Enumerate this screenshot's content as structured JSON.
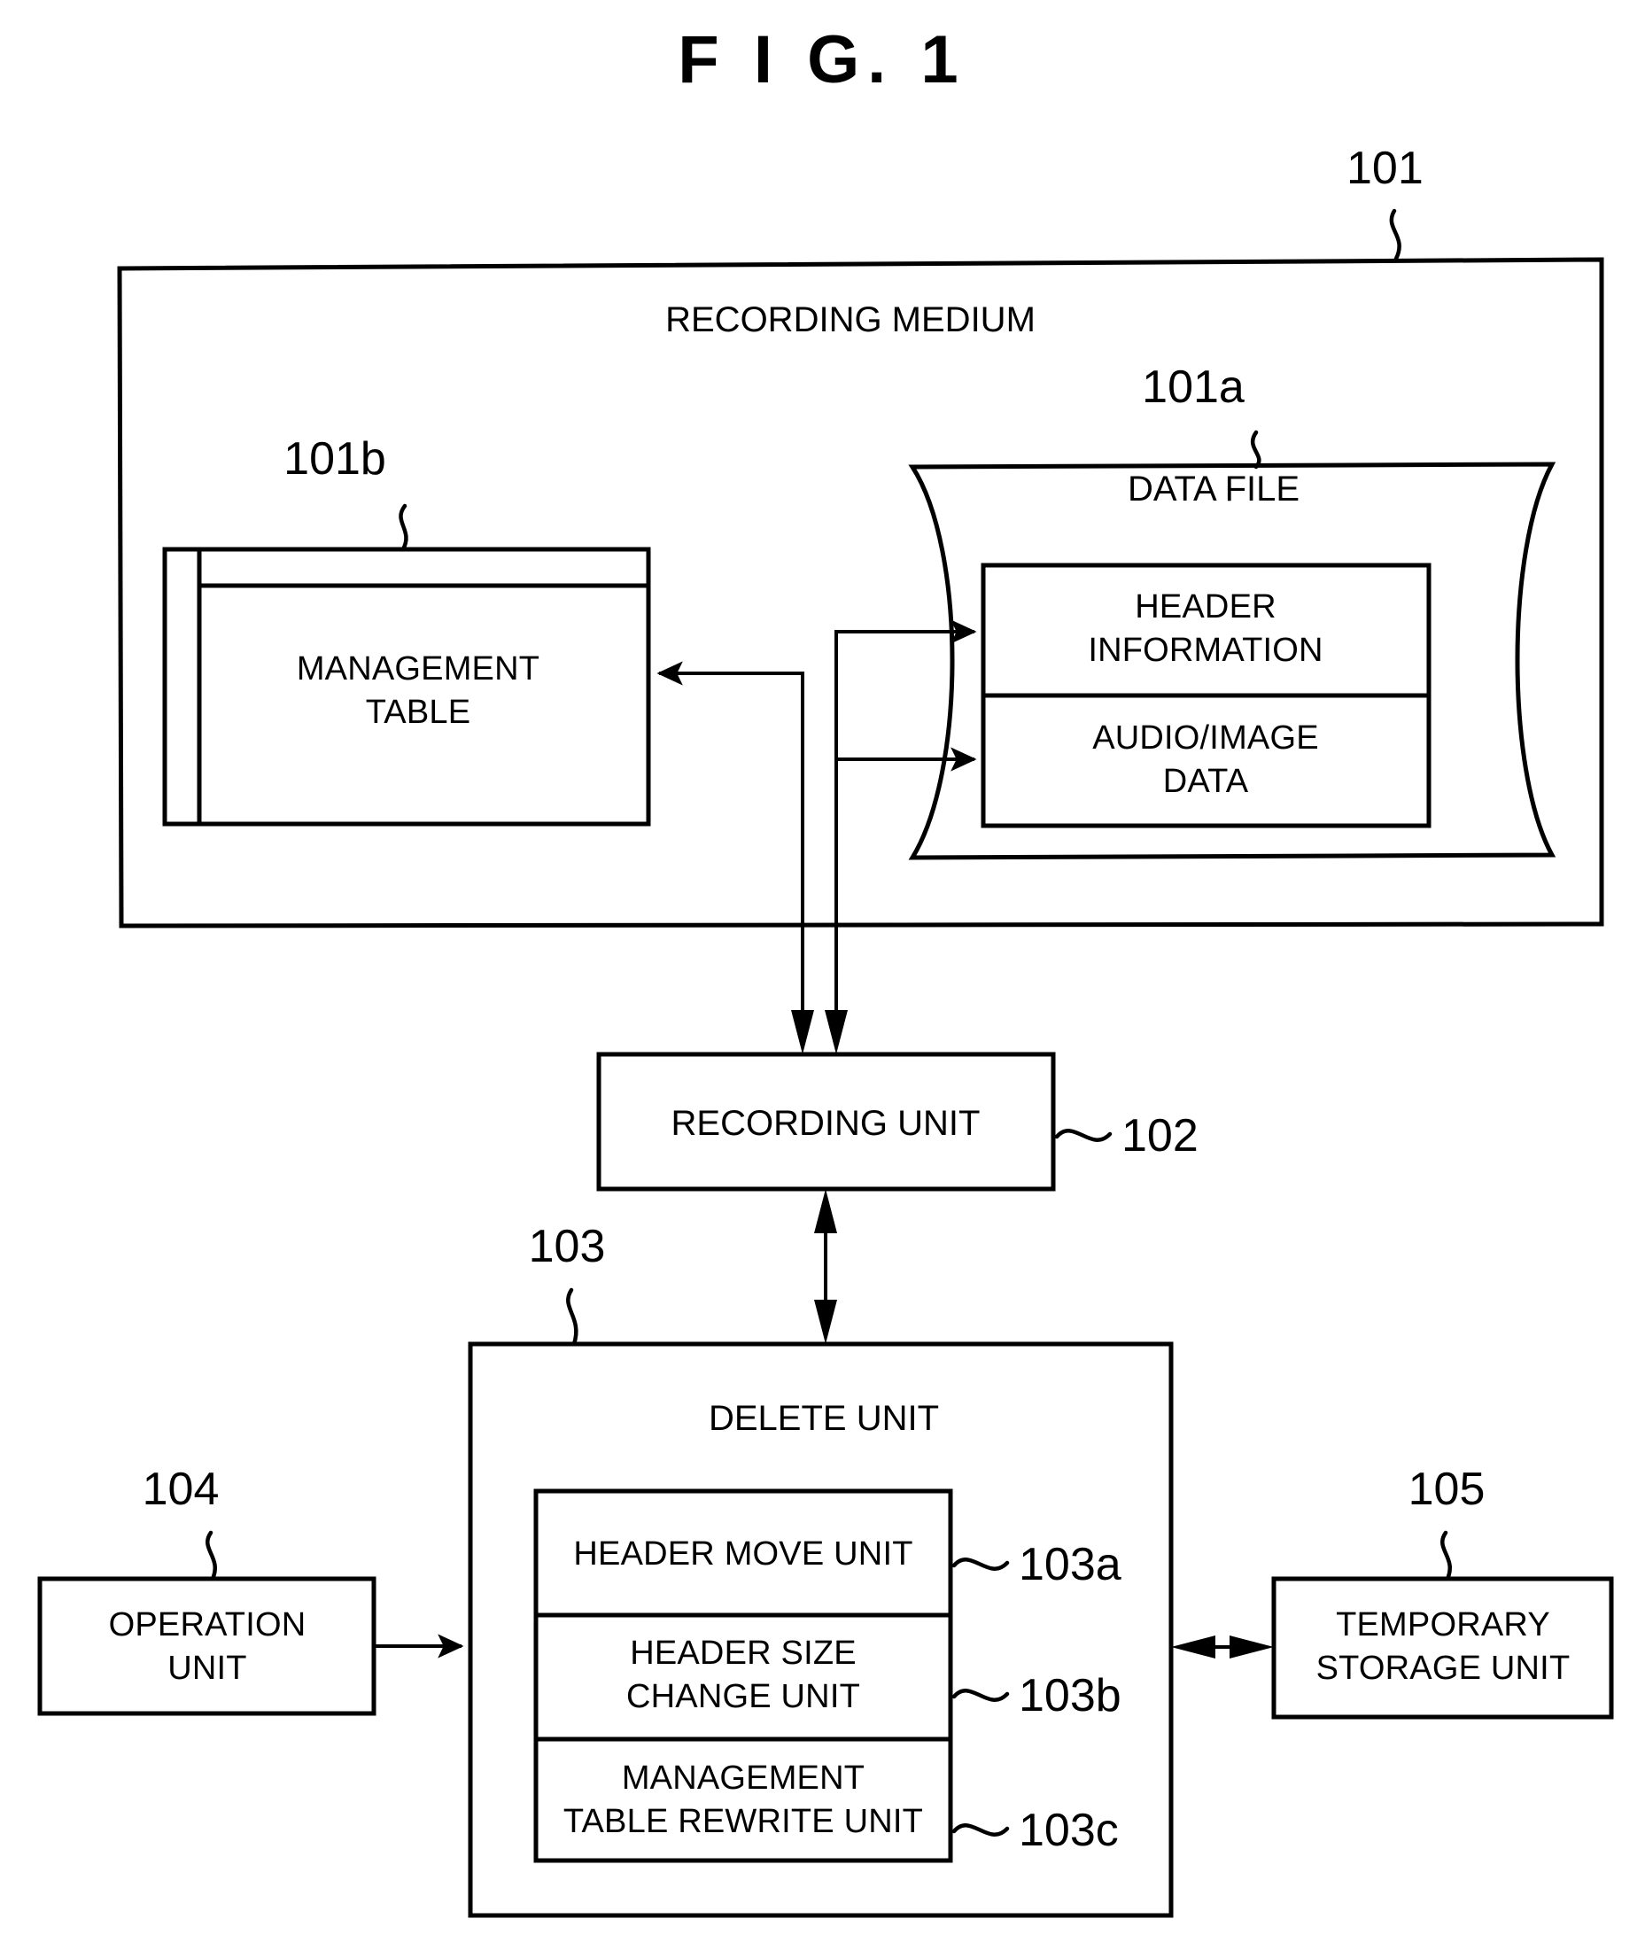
{
  "figure": {
    "title": "F I G. 1",
    "type": "patent-block-diagram"
  },
  "blocks": {
    "recording_medium": {
      "label": "RECORDING MEDIUM",
      "ref": "101"
    },
    "management_table": {
      "label_line1": "MANAGEMENT",
      "label_line2": "TABLE",
      "ref": "101b"
    },
    "data_file": {
      "label": "DATA FILE",
      "ref": "101a",
      "sections": [
        {
          "line1": "HEADER",
          "line2": "INFORMATION",
          "name": "header-information"
        },
        {
          "line1": "AUDIO/IMAGE",
          "line2": "DATA",
          "name": "audio-image-data"
        }
      ]
    },
    "recording_unit": {
      "label": "RECORDING UNIT",
      "ref": "102"
    },
    "delete_unit": {
      "label": "DELETE UNIT",
      "ref": "103",
      "subunits": [
        {
          "line1": "HEADER MOVE UNIT",
          "line2": "",
          "ref": "103a",
          "name": "header-move-unit"
        },
        {
          "line1": "HEADER SIZE",
          "line2": "CHANGE UNIT",
          "ref": "103b",
          "name": "header-size-change-unit"
        },
        {
          "line1": "MANAGEMENT",
          "line2": "TABLE REWRITE UNIT",
          "ref": "103c",
          "name": "management-table-rewrite-unit"
        }
      ]
    },
    "operation_unit": {
      "label_line1": "OPERATION",
      "label_line2": "UNIT",
      "ref": "104"
    },
    "temporary_storage_unit": {
      "label_line1": "TEMPORARY",
      "label_line2": "STORAGE UNIT",
      "ref": "105"
    }
  },
  "connections": [
    {
      "from": "recording-unit",
      "to": "management-table",
      "arrow": "single"
    },
    {
      "from": "recording-unit",
      "to": "header-information",
      "arrow": "single"
    },
    {
      "from": "recording-unit",
      "to": "audio-image-data",
      "arrow": "single"
    },
    {
      "from": "recording-unit",
      "to": "delete-unit",
      "arrow": "double"
    },
    {
      "from": "operation-unit",
      "to": "delete-unit",
      "arrow": "single"
    },
    {
      "from": "delete-unit",
      "to": "temporary-storage-unit",
      "arrow": "double"
    }
  ],
  "colors": {
    "ink": "#000000",
    "paper": "#ffffff"
  }
}
